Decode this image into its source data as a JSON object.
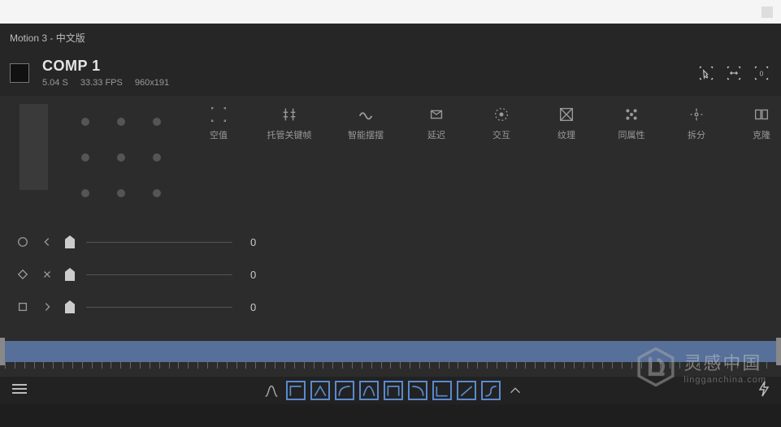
{
  "topbar": {
    "title": "Motion 3 - 中文版"
  },
  "comp": {
    "name": "COMP 1",
    "duration": "5.04 S",
    "fps": "33.33 FPS",
    "size": "960x191"
  },
  "header_actions": [
    {
      "name": "select-mode-icon"
    },
    {
      "name": "fit-width-icon"
    },
    {
      "name": "fit-zero-icon",
      "badge": "0"
    }
  ],
  "tools": [
    {
      "name": "null-tool",
      "label": "空值"
    },
    {
      "name": "keyframe-host-tool",
      "label": "托管关键帧"
    },
    {
      "name": "wiggle-tool",
      "label": "智能摆摆"
    },
    {
      "name": "delay-tool",
      "label": "延迟"
    },
    {
      "name": "interact-tool",
      "label": "交互"
    },
    {
      "name": "texture-tool",
      "label": "纹理"
    },
    {
      "name": "sync-tool",
      "label": "同属性"
    },
    {
      "name": "split-tool",
      "label": "拆分"
    },
    {
      "name": "clone-tool",
      "label": "克隆"
    }
  ],
  "sliders": [
    {
      "name": "slider-circle",
      "value": "0",
      "icon1": "circle",
      "icon2": "chev-left"
    },
    {
      "name": "slider-diamond",
      "value": "0",
      "icon1": "diamond",
      "icon2": "cross"
    },
    {
      "name": "slider-square",
      "value": "0",
      "icon1": "square",
      "icon2": "chev-right"
    }
  ],
  "watermark": {
    "zh": "灵感中国",
    "en": "lingganchina.com"
  }
}
